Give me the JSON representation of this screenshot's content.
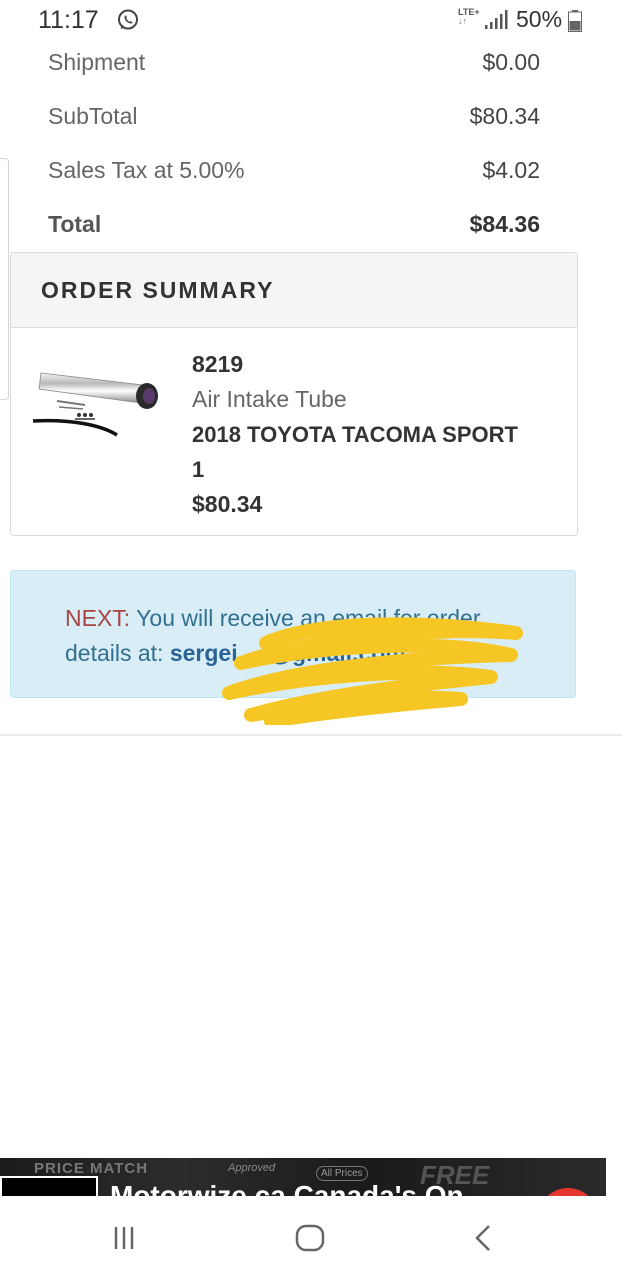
{
  "status_bar": {
    "time": "11:17",
    "network": "LTE+",
    "battery": "50%"
  },
  "totals": [
    {
      "label": "Shipment",
      "value": "$0.00"
    },
    {
      "label": "SubTotal",
      "value": "$80.34"
    },
    {
      "label": "Sales Tax at 5.00%",
      "value": "$4.02"
    },
    {
      "label": "Total",
      "value": "$84.36"
    }
  ],
  "order_summary": {
    "title": "ORDER SUMMARY",
    "item": {
      "sku": "8219",
      "name": "Air Intake Tube",
      "vehicle": "2018 TOYOTA TACOMA SPORT",
      "quantity": "1",
      "price": "$80.34"
    }
  },
  "next": {
    "label": "NEXT:",
    "message": "You will receive an email for order details at:",
    "email": "sergei.....@gmail.com"
  },
  "ad": {
    "small_text": "PRICE MATCH",
    "approved_text": "Approved",
    "all_prices_text": "All Prices",
    "free_text": "FREE",
    "headline": "Motorwize.ca Canada's On"
  },
  "colors": {
    "next_background": "#d9edf7",
    "next_text": "#31708f",
    "next_label": "#a94442",
    "redaction": "#f6c624"
  },
  "icons": {
    "status": [
      "whatsapp-icon",
      "signal-icon",
      "battery-icon"
    ],
    "nav": [
      "recent-apps-icon",
      "home-icon",
      "back-icon"
    ]
  }
}
